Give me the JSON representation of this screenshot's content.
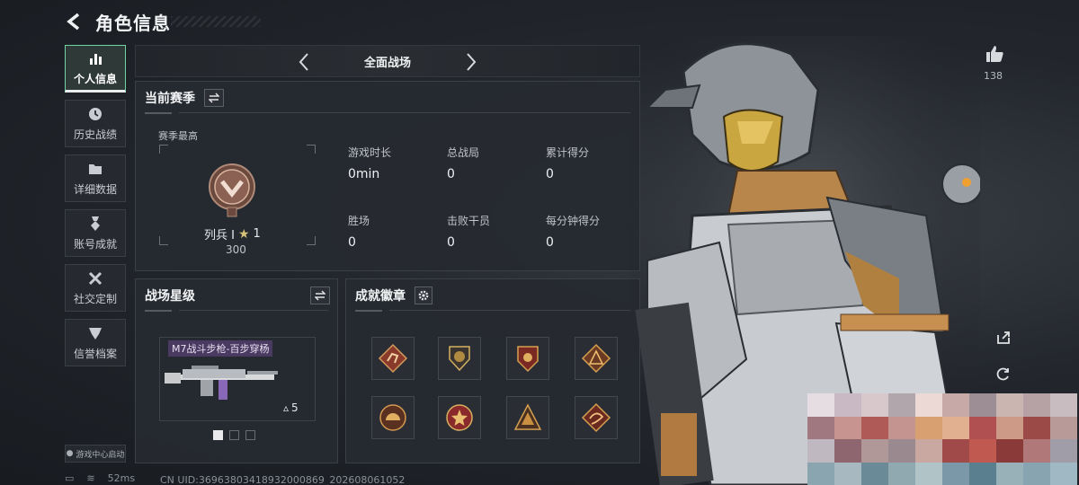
{
  "header": {
    "title": "角色信息"
  },
  "sidebar": {
    "items": [
      {
        "label": "个人信息",
        "icon": "bar-chart-icon",
        "active": true
      },
      {
        "label": "历史战绩",
        "icon": "clock-icon"
      },
      {
        "label": "详细数据",
        "icon": "folder-icon"
      },
      {
        "label": "账号成就",
        "icon": "medal-icon"
      },
      {
        "label": "社交定制",
        "icon": "tools-icon"
      },
      {
        "label": "信誉档案",
        "icon": "shield-icon"
      }
    ],
    "launch": "游戏中心启动"
  },
  "mode_bar": {
    "title": "全面战场"
  },
  "season": {
    "title": "当前赛季",
    "best_label": "赛季最高",
    "rank_name": "列兵 I",
    "rank_stars": "1",
    "rank_score": "300",
    "stats": [
      {
        "label": "游戏时长",
        "value": "0min"
      },
      {
        "label": "总战局",
        "value": "0"
      },
      {
        "label": "累计得分",
        "value": "0"
      },
      {
        "label": "胜场",
        "value": "0"
      },
      {
        "label": "击败干员",
        "value": "0"
      },
      {
        "label": "每分钟得分",
        "value": "0"
      }
    ]
  },
  "star_level": {
    "title": "战场星级",
    "weapon_name": "M7战斗步枪-百步穿杨",
    "weapon_level": "5"
  },
  "achievements": {
    "title": "成就徽章",
    "badges": [
      "sprint-icon",
      "crest-icon",
      "shield-badge-icon",
      "rank-triangle-icon",
      "helmet-icon",
      "star-badge-icon",
      "pyramid-icon",
      "dragon-icon"
    ]
  },
  "right": {
    "likes": "138"
  },
  "status": {
    "ping": "52ms",
    "uid": "CN UID:36963803418932000869_202608061052"
  },
  "colors": {
    "accent": "#6fd3a6",
    "panel": "#262a30",
    "weapon_tag": "#4a3a62"
  }
}
